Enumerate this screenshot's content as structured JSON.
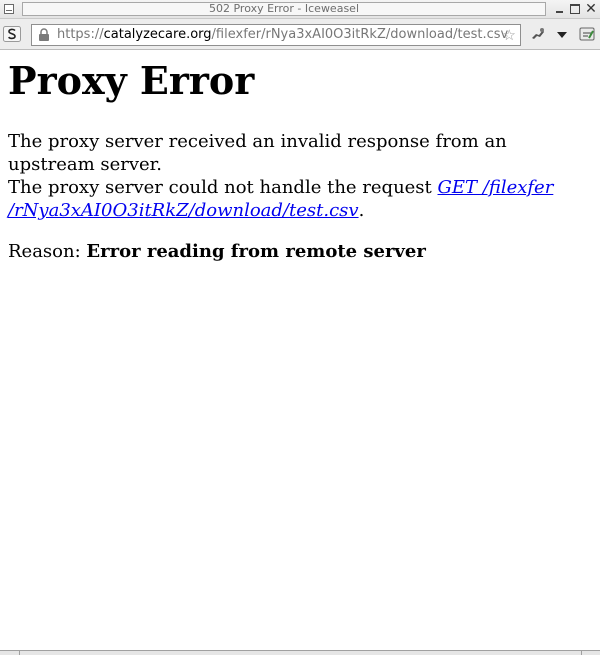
{
  "window": {
    "title": "502 Proxy Error - Iceweasel"
  },
  "toolbar": {
    "url_scheme": "https://",
    "url_host": "catalyzecare.org",
    "url_path": "/filexfer/rNya3xAI0O3itRkZ/download/test.csv",
    "icons": {
      "identity": "site-identity-icon",
      "lock": "lock-icon",
      "bookmark": "star-icon",
      "addon": "addon-icon",
      "menu": "dropdown-arrow-icon",
      "tools": "tools-icon"
    }
  },
  "page": {
    "heading": "Proxy Error",
    "line1": "The proxy server received an invalid response from an upstream server.",
    "line2_prefix": "The proxy server could not handle the request ",
    "link_line1": "GET /filexfer",
    "link_line2": "/rNya3xAI0O3itRkZ/download/test.csv",
    "line2_suffix": ".",
    "reason_label": "Reason: ",
    "reason_value": "Error reading from remote server"
  },
  "colors": {
    "link": "#0000ee",
    "text": "#000000",
    "background": "#ffffff"
  }
}
